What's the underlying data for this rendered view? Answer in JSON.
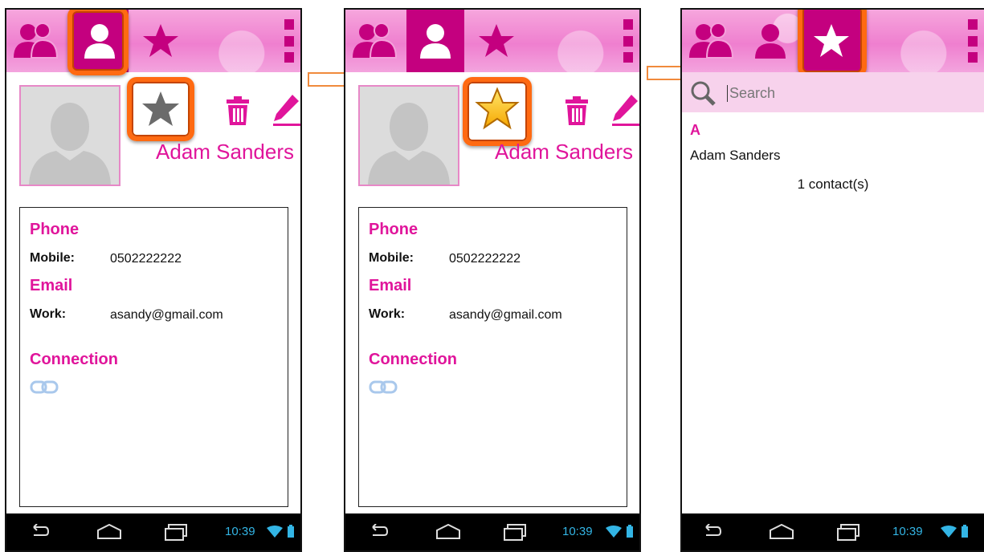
{
  "contact": {
    "name": "Adam Sanders",
    "phone_header": "Phone",
    "mobile_label": "Mobile:",
    "mobile_value": "0502222222",
    "email_header": "Email",
    "work_label": "Work:",
    "work_value": "asandy@gmail.com",
    "connection_header": "Connection"
  },
  "status": {
    "time": "10:39"
  },
  "favorites": {
    "search_placeholder": "Search",
    "section_letter": "A",
    "items": [
      "Adam Sanders"
    ],
    "count_text": "1 contact(s)"
  },
  "colors": {
    "accent": "#e0159b",
    "tab_active": "#c4007f",
    "highlight": "#ff6a12",
    "clock": "#33b5e5"
  }
}
